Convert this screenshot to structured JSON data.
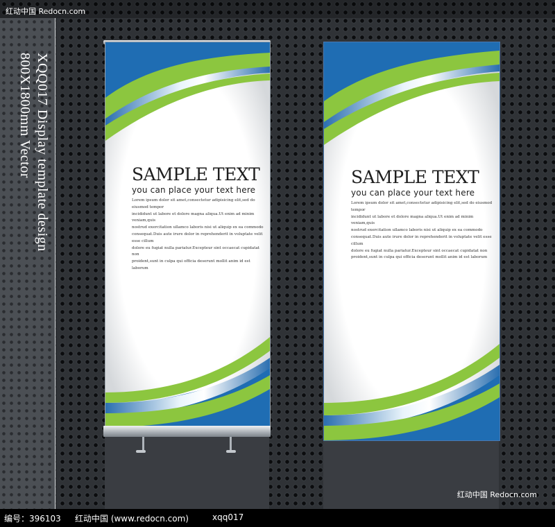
{
  "header": {
    "watermark": "红动中国 Redocn.com"
  },
  "side_panel": {
    "line1": "XQQ017 Display template design",
    "line2": "800X1800mm Vector"
  },
  "banners": [
    {
      "title": "SAMPLE TEXT",
      "subtitle": "you can place your text here",
      "body": "Lorem ipsum dolor sit amet,consectetur adipisicing elit,sed do eiusmod tempor\nincididunt ut labore et dolore magna aliqua.Ut enim ad minim veniam,quis\nnostrud exercitation ullamco laboris nisi ut aliquip ex ea commodo\nconsequat.Duis aute irure dolor in reprehenderit in voluptate velit esse cillum\ndolore eu fugiat nulla pariatur.Excepteur sint occaecat cupidatat non\nproident,sunt in culpa qui officia deserunt mollit anim id est laborum"
    },
    {
      "title": "SAMPLE TEXT",
      "subtitle": "you can place your text here",
      "body": "Lorem ipsum dolor sit amet,consectetur adipisicing elit,sed do eiusmod tempor\nincididunt ut labore et dolore magna aliqua.Ut enim ad minim veniam,quis\nnostrud exercitation ullamco laboris nisi ut aliquip ex ea commodo\nconsequat.Duis aute irure dolor in reprehenderit in voluptate velit esse cillum\ndolore eu fugiat nulla pariatur.Excepteur sint occaecat cupidatat non\nproident,sunt in culpa qui officia deserunt mollit anim id est laborum"
    }
  ],
  "watermark_bottom": "红动中国 Redocn.com",
  "footer": {
    "id_text": "编号：396103",
    "site_text": "红动中国 (www.redocn.com)",
    "code_text": "xqq017"
  },
  "colors": {
    "green": "#8cc63f",
    "blue": "#1f6db3",
    "background": "#2f3236"
  }
}
